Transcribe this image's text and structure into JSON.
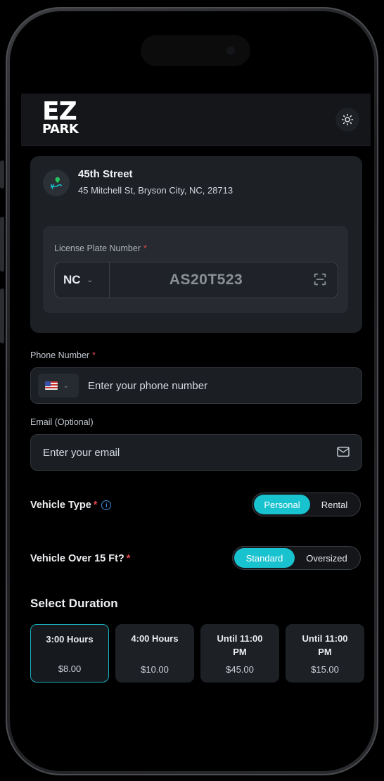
{
  "app": {
    "logo_top": "EZ",
    "logo_bottom": "PARK",
    "theme_icon": "sun-icon"
  },
  "location": {
    "title": "45th Street",
    "address": "45 Mitchell St, Bryson City, NC, 28713",
    "icon": "map-pin-icon"
  },
  "plate": {
    "label": "License Plate Number",
    "required_mark": "*",
    "state": "NC",
    "number": "AS20T523",
    "scan_icon": "scan-icon"
  },
  "phone": {
    "label": "Phone Number",
    "required_mark": "*",
    "country_flag": "us-flag-icon",
    "placeholder": "Enter your phone number"
  },
  "email": {
    "label": "Email (Optional)",
    "placeholder": "Enter your email",
    "icon": "mail-icon"
  },
  "vehicle_type": {
    "label": "Vehicle Type",
    "required_mark": "*",
    "options": [
      "Personal",
      "Rental"
    ],
    "selected": "Personal"
  },
  "vehicle_size": {
    "label": "Vehicle Over 15 Ft?",
    "required_mark": "*",
    "options": [
      "Standard",
      "Oversized"
    ],
    "selected": "Standard"
  },
  "duration": {
    "title": "Select Duration",
    "options": [
      {
        "label": "3:00 Hours",
        "price": "$8.00",
        "selected": true
      },
      {
        "label": "4:00 Hours",
        "price": "$10.00",
        "selected": false
      },
      {
        "label": "Until 11:00 PM",
        "price": "$45.00",
        "selected": false
      },
      {
        "label": "Until 11:00 PM",
        "price": "$15.00",
        "selected": false
      }
    ]
  },
  "colors": {
    "accent": "#19c2cf",
    "required": "#e5484d",
    "info": "#3d8bd9"
  }
}
